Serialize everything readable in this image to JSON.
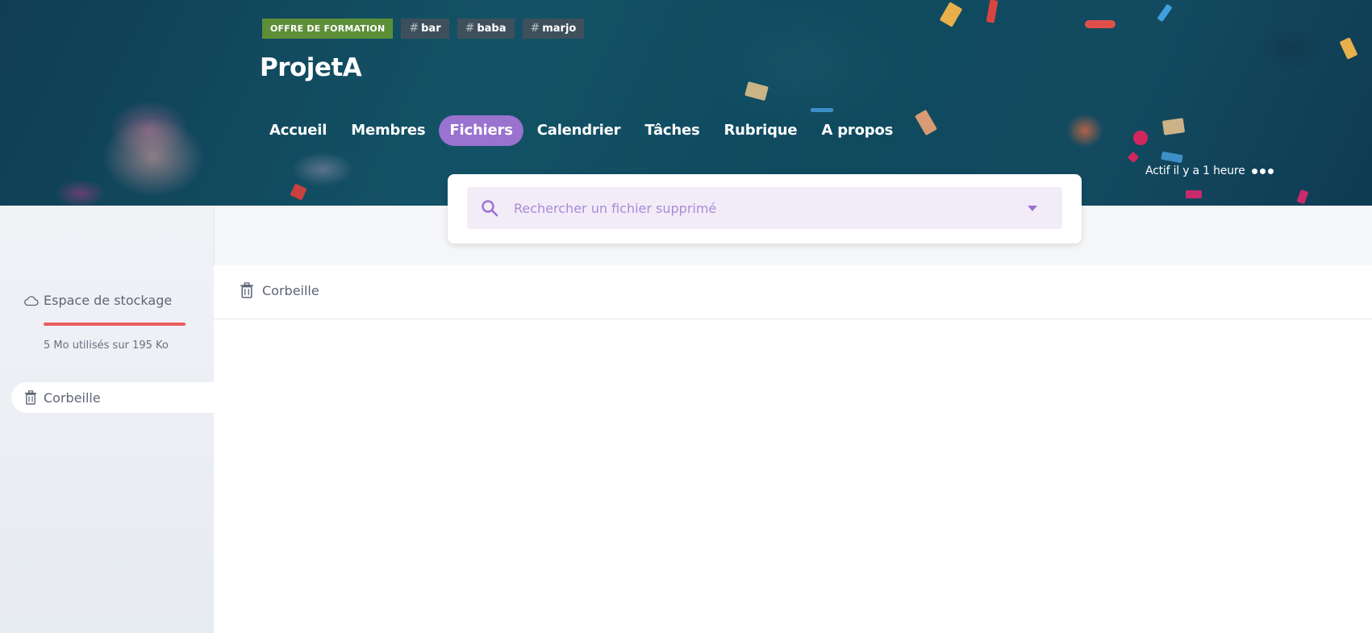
{
  "banner": {
    "tags": {
      "offer": "OFFRE DE FORMATION",
      "items": [
        {
          "hash": "#",
          "label": "bar"
        },
        {
          "hash": "#",
          "label": "baba"
        },
        {
          "hash": "#",
          "label": "marjo"
        }
      ]
    },
    "project_title": "ProjetA",
    "nav": [
      "Accueil",
      "Membres",
      "Fichiers",
      "Calendrier",
      "Tâches",
      "Rubrique",
      "A propos"
    ],
    "active_nav": "Fichiers",
    "activity": "Actif il y a 1 heure"
  },
  "search": {
    "placeholder": "Rechercher un fichier supprimé"
  },
  "sidebar": {
    "storage_label": "Espace de stockage",
    "storage_usage": "5 Mo utilisés sur 195 Ko",
    "trash_label": "Corbeille"
  },
  "main": {
    "breadcrumb_label": "Corbeille"
  },
  "colors": {
    "accent": "#9a72cf",
    "offer_tag": "#5d8f37",
    "storage_bar": "#e85d5d",
    "banner": "#135266"
  },
  "icons": {
    "search": "search-icon",
    "dropdown": "caret-down-icon",
    "storage": "cloud-icon",
    "trash": "trash-icon",
    "more": "more-dots-icon"
  }
}
